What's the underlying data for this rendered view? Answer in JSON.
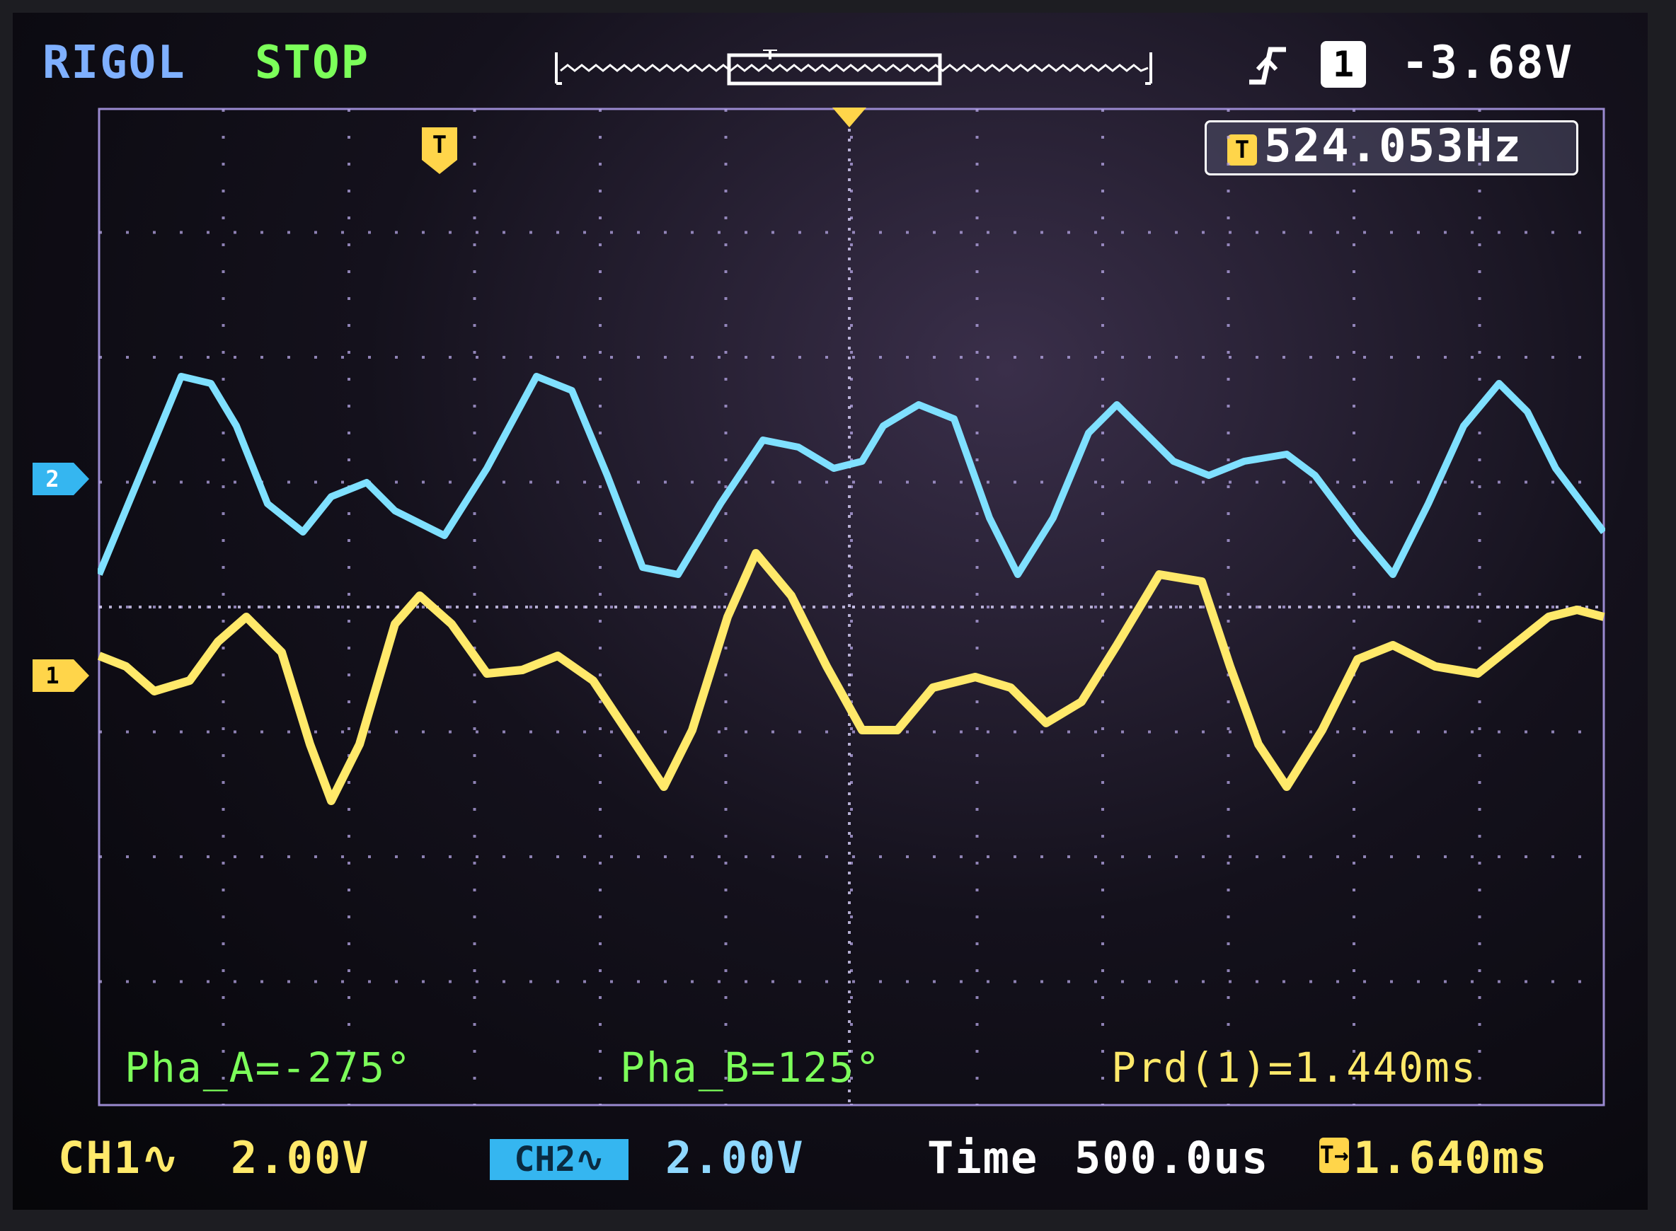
{
  "header": {
    "brand": "RIGOL",
    "run_state": "STOP",
    "trigger_source": "1",
    "trigger_level": "-3.68V",
    "trigger_edge_icon": "rising-edge-trigger-icon"
  },
  "frequency_box": {
    "icon": "T",
    "value": "524.053Hz"
  },
  "markers": {
    "trigger_marker": "T",
    "ch1_marker": "1",
    "ch2_marker": "2"
  },
  "measurements": {
    "phase_a": "Pha_A=-275°",
    "phase_b": "Pha_B=125°",
    "period": "Prd(1)=1.440ms"
  },
  "footer": {
    "ch1_label": "CH1∿",
    "ch1_scale": "2.00V",
    "ch2_label": "CH2∿",
    "ch2_scale": "2.00V",
    "time_label": "Time",
    "time_scale": "500.0us",
    "offset_icon": "T→",
    "offset_value": "1.640ms"
  },
  "colors": {
    "ch1": "#ffe96a",
    "ch2": "#7fe0ff",
    "grid": "#b8a8e8",
    "status_green": "#7cff5a"
  }
}
